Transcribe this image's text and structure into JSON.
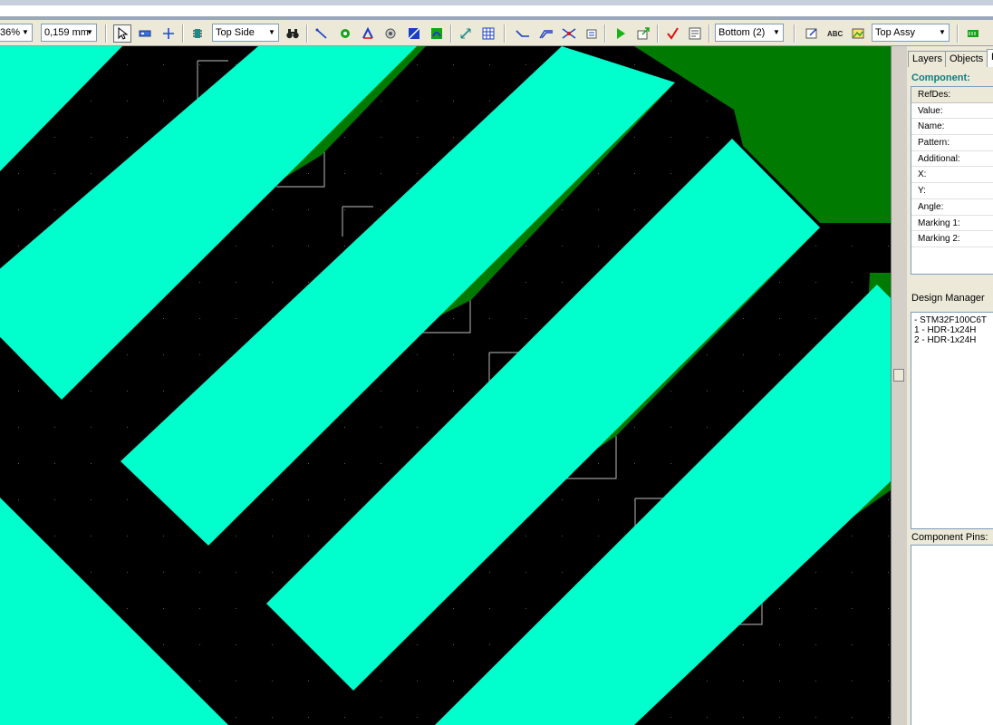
{
  "toolbar": {
    "zoom_value": "36%",
    "grid_value": "0,159 mm",
    "side_value": "Top Side",
    "layer_value": "Bottom (2)",
    "assy_value": "Top Assy",
    "icons": [
      "select-arrow-icon",
      "place-component-icon",
      "crosshair-icon",
      "chip-icon",
      "binoculars-icon",
      "route-wire-icon",
      "via-icon",
      "text-icon",
      "pad-icon",
      "polygon-icon",
      "copper-pour-icon",
      "dimension-icon",
      "table-icon",
      "manual-route-icon",
      "multi-route-icon",
      "bus-route-icon",
      "autoroute-icon",
      "run-icon",
      "export-icon",
      "drc-icon",
      "drc-report-icon",
      "properties-icon",
      "spell-abc-icon",
      "image-icon",
      "layers-view-icon"
    ]
  },
  "canvas": {
    "background": "#000000",
    "trace_color": "#00ffcc",
    "pour_color": "#007a00",
    "outline_color": "#9a9a9a"
  },
  "panel": {
    "tabs": [
      "Layers",
      "Objects",
      "F"
    ],
    "component_title": "Component:",
    "component_fields": [
      "RefDes:",
      "Value:",
      "Name:",
      "Pattern:",
      "Additional:",
      "X:",
      "Y:",
      "Angle:",
      "Marking 1:",
      "Marking 2:"
    ],
    "design_manager_title": "Design Manager",
    "design_items": [
      " - STM32F100C6T",
      "1 - HDR-1x24H",
      "2 - HDR-1x24H"
    ],
    "component_pins_title": "Component Pins:"
  }
}
